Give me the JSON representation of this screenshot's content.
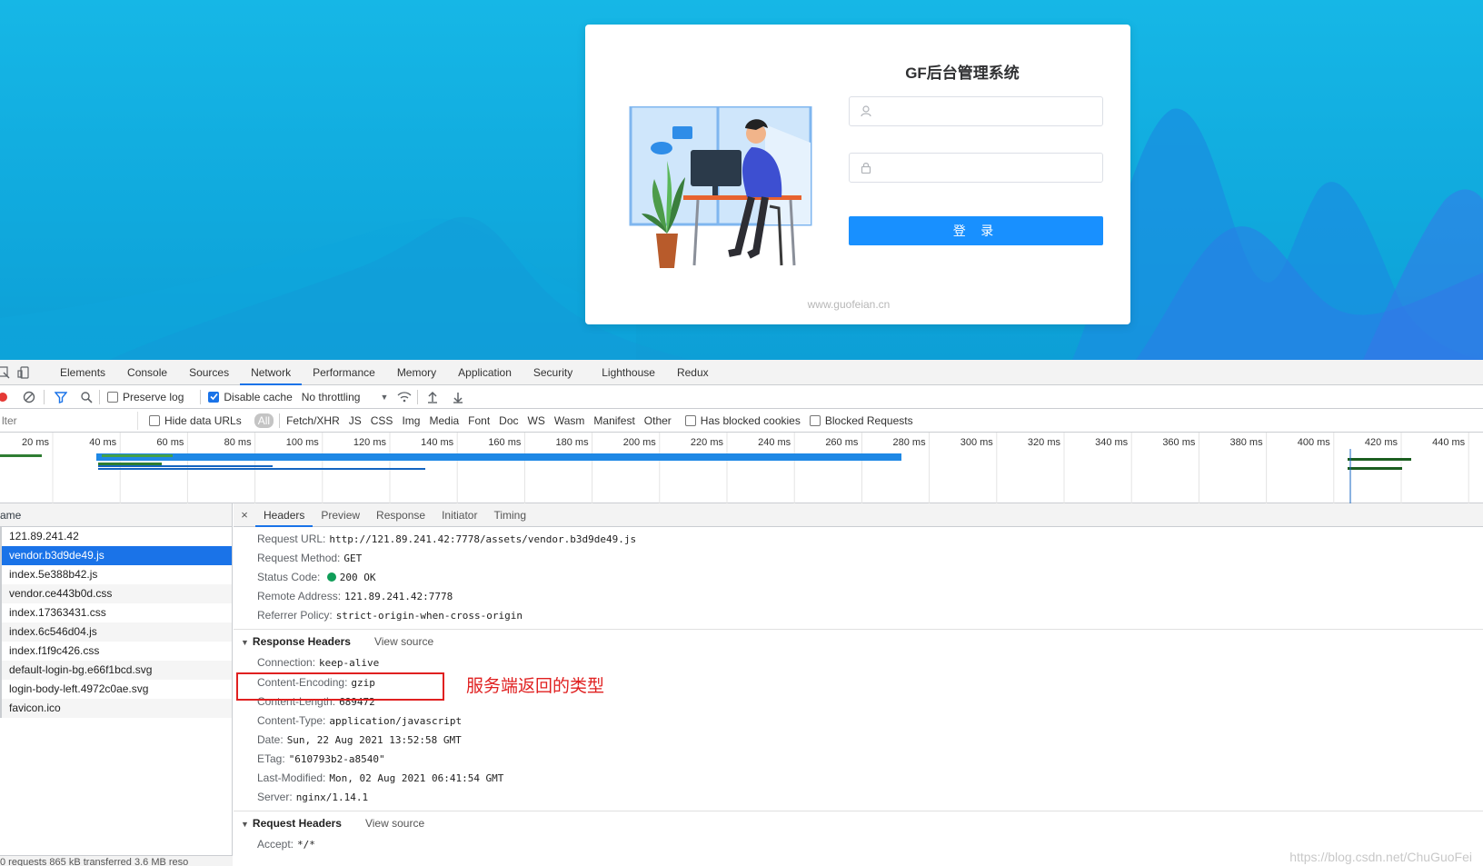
{
  "login": {
    "title": "GF后台管理系统",
    "username_placeholder": "",
    "password_placeholder": "",
    "button_label": "登 录",
    "site_watermark": "www.guofeian.cn"
  },
  "devtools": {
    "tabs": [
      "Elements",
      "Console",
      "Sources",
      "Network",
      "Performance",
      "Memory",
      "Application",
      "Security",
      "Lighthouse",
      "Redux"
    ],
    "active_tab": "Network",
    "toolbar": {
      "preserve_log": "Preserve log",
      "disable_cache": "Disable cache",
      "throttling": "No throttling"
    },
    "filter": {
      "placeholder": "lter",
      "hide_data_urls": "Hide data URLs",
      "types": [
        "All",
        "Fetch/XHR",
        "JS",
        "CSS",
        "Img",
        "Media",
        "Font",
        "Doc",
        "WS",
        "Wasm",
        "Manifest",
        "Other"
      ],
      "has_blocked_cookies": "Has blocked cookies",
      "blocked_requests": "Blocked Requests"
    },
    "timeline_ticks": [
      "20 ms",
      "40 ms",
      "60 ms",
      "80 ms",
      "100 ms",
      "120 ms",
      "140 ms",
      "160 ms",
      "180 ms",
      "200 ms",
      "220 ms",
      "240 ms",
      "260 ms",
      "280 ms",
      "300 ms",
      "320 ms",
      "340 ms",
      "360 ms",
      "380 ms",
      "400 ms",
      "420 ms",
      "440 ms"
    ],
    "request_list": {
      "header": "ame",
      "rows": [
        "121.89.241.42",
        "vendor.b3d9de49.js",
        "index.5e388b42.js",
        "vendor.ce443b0d.css",
        "index.17363431.css",
        "index.6c546d04.js",
        "index.f1f9c426.css",
        "default-login-bg.e66f1bcd.svg",
        "login-body-left.4972c0ae.svg",
        "favicon.ico"
      ],
      "selected_index": 1,
      "status": "0 requests   865 kB transferred   3.6 MB reso"
    },
    "detail": {
      "tabs": [
        "Headers",
        "Preview",
        "Response",
        "Initiator",
        "Timing"
      ],
      "active": "Headers",
      "close": "×",
      "general": [
        {
          "k": "Request URL:",
          "v": "http://121.89.241.42:7778/assets/vendor.b3d9de49.js"
        },
        {
          "k": "Request Method:",
          "v": "GET"
        },
        {
          "k": "Status Code:",
          "v": "200 OK"
        },
        {
          "k": "Remote Address:",
          "v": "121.89.241.42:7778"
        },
        {
          "k": "Referrer Policy:",
          "v": "strict-origin-when-cross-origin"
        }
      ],
      "response_headers_title": "Response Headers",
      "view_source": "View source",
      "response_headers": [
        {
          "k": "Connection:",
          "v": "keep-alive"
        },
        {
          "k": "Content-Encoding:",
          "v": "gzip"
        },
        {
          "k": "Content-Length:",
          "v": "689472"
        },
        {
          "k": "Content-Type:",
          "v": "application/javascript"
        },
        {
          "k": "Date:",
          "v": "Sun, 22 Aug 2021 13:52:58 GMT"
        },
        {
          "k": "ETag:",
          "v": "\"610793b2-a8540\""
        },
        {
          "k": "Last-Modified:",
          "v": "Mon, 02 Aug 2021 06:41:54 GMT"
        },
        {
          "k": "Server:",
          "v": "nginx/1.14.1"
        }
      ],
      "request_headers_title": "Request Headers",
      "request_headers": [
        {
          "k": "Accept:",
          "v": "*/*"
        }
      ]
    },
    "annotation": "服务端返回的类型",
    "csdn_watermark": "https://blog.csdn.net/ChuGuoFei"
  },
  "colors": {
    "page_bg": "#14b3e4",
    "login_button": "#1890ff",
    "devtools_accent": "#1a73e8",
    "annotation_red": "#e02020",
    "status_ok_green": "#0f9d58"
  }
}
